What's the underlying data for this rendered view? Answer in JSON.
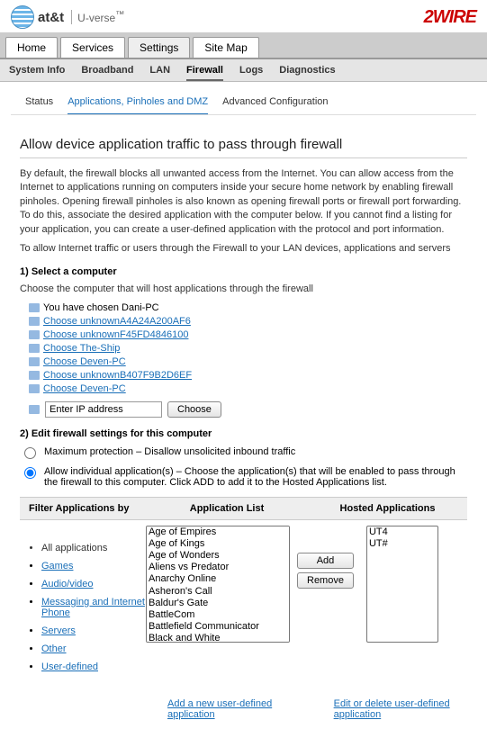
{
  "header": {
    "brand1_bold": "at&t",
    "brand1_sub": "U-verse",
    "brand1_tm": "™",
    "brand2": "2WIRE"
  },
  "tabs1": {
    "home": "Home",
    "services": "Services",
    "settings": "Settings",
    "sitemap": "Site Map"
  },
  "tabs2": {
    "sysinfo": "System Info",
    "broadband": "Broadband",
    "lan": "LAN",
    "firewall": "Firewall",
    "logs": "Logs",
    "diag": "Diagnostics"
  },
  "subtabs": {
    "status": "Status",
    "apps": "Applications, Pinholes and DMZ",
    "adv": "Advanced Configuration"
  },
  "page": {
    "title": "Allow device application traffic to pass through firewall",
    "intro": "By default, the firewall blocks all unwanted access from the Internet. You can allow access from the Internet to applications running on computers inside your secure home network by enabling firewall pinholes. Opening firewall pinholes is also known as opening firewall ports or firewall port forwarding. To do this, associate the desired application with the computer below. If you cannot find a listing for your application, you can create a user-defined application with the protocol and port information.",
    "intro2": "To allow Internet traffic or users through the Firewall to your LAN devices, applications and servers",
    "step1": "1) Select a computer",
    "step1_desc": "Choose the computer that will host applications through the firewall",
    "chosen": "You have chosen Dani-PC",
    "computers": [
      "Choose unknownA4A24A200AF6",
      "Choose unknownF45FD4846100",
      "Choose The-Ship",
      "Choose Deven-PC",
      "Choose unknownB407F9B2D6EF",
      "Choose Deven-PC"
    ],
    "ip_placeholder": "Enter IP address",
    "choose_btn": "Choose",
    "step2": "2) Edit firewall settings for this computer",
    "radio_max": "Maximum protection – Disallow unsolicited inbound traffic",
    "radio_allow": "Allow individual application(s) – Choose the application(s) that will be enabled to pass through the firewall to this computer. Click ADD to add it to the Hosted Applications list.",
    "filter_hdr": "Filter Applications by",
    "applist_hdr": "Application List",
    "hosted_hdr": "Hosted Applications",
    "filters": {
      "all": "All applications",
      "games": "Games",
      "av": "Audio/video",
      "msg": "Messaging and Internet Phone",
      "servers": "Servers",
      "other": "Other",
      "user": "User-defined"
    },
    "applist": [
      "Age of Empires",
      "Age of Kings",
      "Age of Wonders",
      "Aliens vs Predator",
      "Anarchy Online",
      "Asheron's Call",
      "Baldur's Gate",
      "BattleCom",
      "Battlefield Communicator",
      "Black and White"
    ],
    "add_btn": "Add",
    "remove_btn": "Remove",
    "hosted": [
      "UT4",
      "UT#"
    ],
    "add_new": "Add a new user-defined application",
    "edit_del": "Edit or delete user-defined application"
  }
}
